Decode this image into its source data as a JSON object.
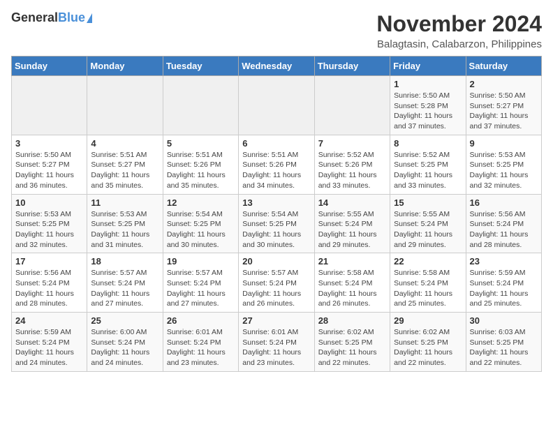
{
  "header": {
    "logo_general": "General",
    "logo_blue": "Blue",
    "month_year": "November 2024",
    "location": "Balagtasin, Calabarzon, Philippines"
  },
  "weekdays": [
    "Sunday",
    "Monday",
    "Tuesday",
    "Wednesday",
    "Thursday",
    "Friday",
    "Saturday"
  ],
  "weeks": [
    [
      {
        "day": "",
        "info": ""
      },
      {
        "day": "",
        "info": ""
      },
      {
        "day": "",
        "info": ""
      },
      {
        "day": "",
        "info": ""
      },
      {
        "day": "",
        "info": ""
      },
      {
        "day": "1",
        "info": "Sunrise: 5:50 AM\nSunset: 5:28 PM\nDaylight: 11 hours\nand 37 minutes."
      },
      {
        "day": "2",
        "info": "Sunrise: 5:50 AM\nSunset: 5:27 PM\nDaylight: 11 hours\nand 37 minutes."
      }
    ],
    [
      {
        "day": "3",
        "info": "Sunrise: 5:50 AM\nSunset: 5:27 PM\nDaylight: 11 hours\nand 36 minutes."
      },
      {
        "day": "4",
        "info": "Sunrise: 5:51 AM\nSunset: 5:27 PM\nDaylight: 11 hours\nand 35 minutes."
      },
      {
        "day": "5",
        "info": "Sunrise: 5:51 AM\nSunset: 5:26 PM\nDaylight: 11 hours\nand 35 minutes."
      },
      {
        "day": "6",
        "info": "Sunrise: 5:51 AM\nSunset: 5:26 PM\nDaylight: 11 hours\nand 34 minutes."
      },
      {
        "day": "7",
        "info": "Sunrise: 5:52 AM\nSunset: 5:26 PM\nDaylight: 11 hours\nand 33 minutes."
      },
      {
        "day": "8",
        "info": "Sunrise: 5:52 AM\nSunset: 5:25 PM\nDaylight: 11 hours\nand 33 minutes."
      },
      {
        "day": "9",
        "info": "Sunrise: 5:53 AM\nSunset: 5:25 PM\nDaylight: 11 hours\nand 32 minutes."
      }
    ],
    [
      {
        "day": "10",
        "info": "Sunrise: 5:53 AM\nSunset: 5:25 PM\nDaylight: 11 hours\nand 32 minutes."
      },
      {
        "day": "11",
        "info": "Sunrise: 5:53 AM\nSunset: 5:25 PM\nDaylight: 11 hours\nand 31 minutes."
      },
      {
        "day": "12",
        "info": "Sunrise: 5:54 AM\nSunset: 5:25 PM\nDaylight: 11 hours\nand 30 minutes."
      },
      {
        "day": "13",
        "info": "Sunrise: 5:54 AM\nSunset: 5:25 PM\nDaylight: 11 hours\nand 30 minutes."
      },
      {
        "day": "14",
        "info": "Sunrise: 5:55 AM\nSunset: 5:24 PM\nDaylight: 11 hours\nand 29 minutes."
      },
      {
        "day": "15",
        "info": "Sunrise: 5:55 AM\nSunset: 5:24 PM\nDaylight: 11 hours\nand 29 minutes."
      },
      {
        "day": "16",
        "info": "Sunrise: 5:56 AM\nSunset: 5:24 PM\nDaylight: 11 hours\nand 28 minutes."
      }
    ],
    [
      {
        "day": "17",
        "info": "Sunrise: 5:56 AM\nSunset: 5:24 PM\nDaylight: 11 hours\nand 28 minutes."
      },
      {
        "day": "18",
        "info": "Sunrise: 5:57 AM\nSunset: 5:24 PM\nDaylight: 11 hours\nand 27 minutes."
      },
      {
        "day": "19",
        "info": "Sunrise: 5:57 AM\nSunset: 5:24 PM\nDaylight: 11 hours\nand 27 minutes."
      },
      {
        "day": "20",
        "info": "Sunrise: 5:57 AM\nSunset: 5:24 PM\nDaylight: 11 hours\nand 26 minutes."
      },
      {
        "day": "21",
        "info": "Sunrise: 5:58 AM\nSunset: 5:24 PM\nDaylight: 11 hours\nand 26 minutes."
      },
      {
        "day": "22",
        "info": "Sunrise: 5:58 AM\nSunset: 5:24 PM\nDaylight: 11 hours\nand 25 minutes."
      },
      {
        "day": "23",
        "info": "Sunrise: 5:59 AM\nSunset: 5:24 PM\nDaylight: 11 hours\nand 25 minutes."
      }
    ],
    [
      {
        "day": "24",
        "info": "Sunrise: 5:59 AM\nSunset: 5:24 PM\nDaylight: 11 hours\nand 24 minutes."
      },
      {
        "day": "25",
        "info": "Sunrise: 6:00 AM\nSunset: 5:24 PM\nDaylight: 11 hours\nand 24 minutes."
      },
      {
        "day": "26",
        "info": "Sunrise: 6:01 AM\nSunset: 5:24 PM\nDaylight: 11 hours\nand 23 minutes."
      },
      {
        "day": "27",
        "info": "Sunrise: 6:01 AM\nSunset: 5:24 PM\nDaylight: 11 hours\nand 23 minutes."
      },
      {
        "day": "28",
        "info": "Sunrise: 6:02 AM\nSunset: 5:25 PM\nDaylight: 11 hours\nand 22 minutes."
      },
      {
        "day": "29",
        "info": "Sunrise: 6:02 AM\nSunset: 5:25 PM\nDaylight: 11 hours\nand 22 minutes."
      },
      {
        "day": "30",
        "info": "Sunrise: 6:03 AM\nSunset: 5:25 PM\nDaylight: 11 hours\nand 22 minutes."
      }
    ]
  ]
}
